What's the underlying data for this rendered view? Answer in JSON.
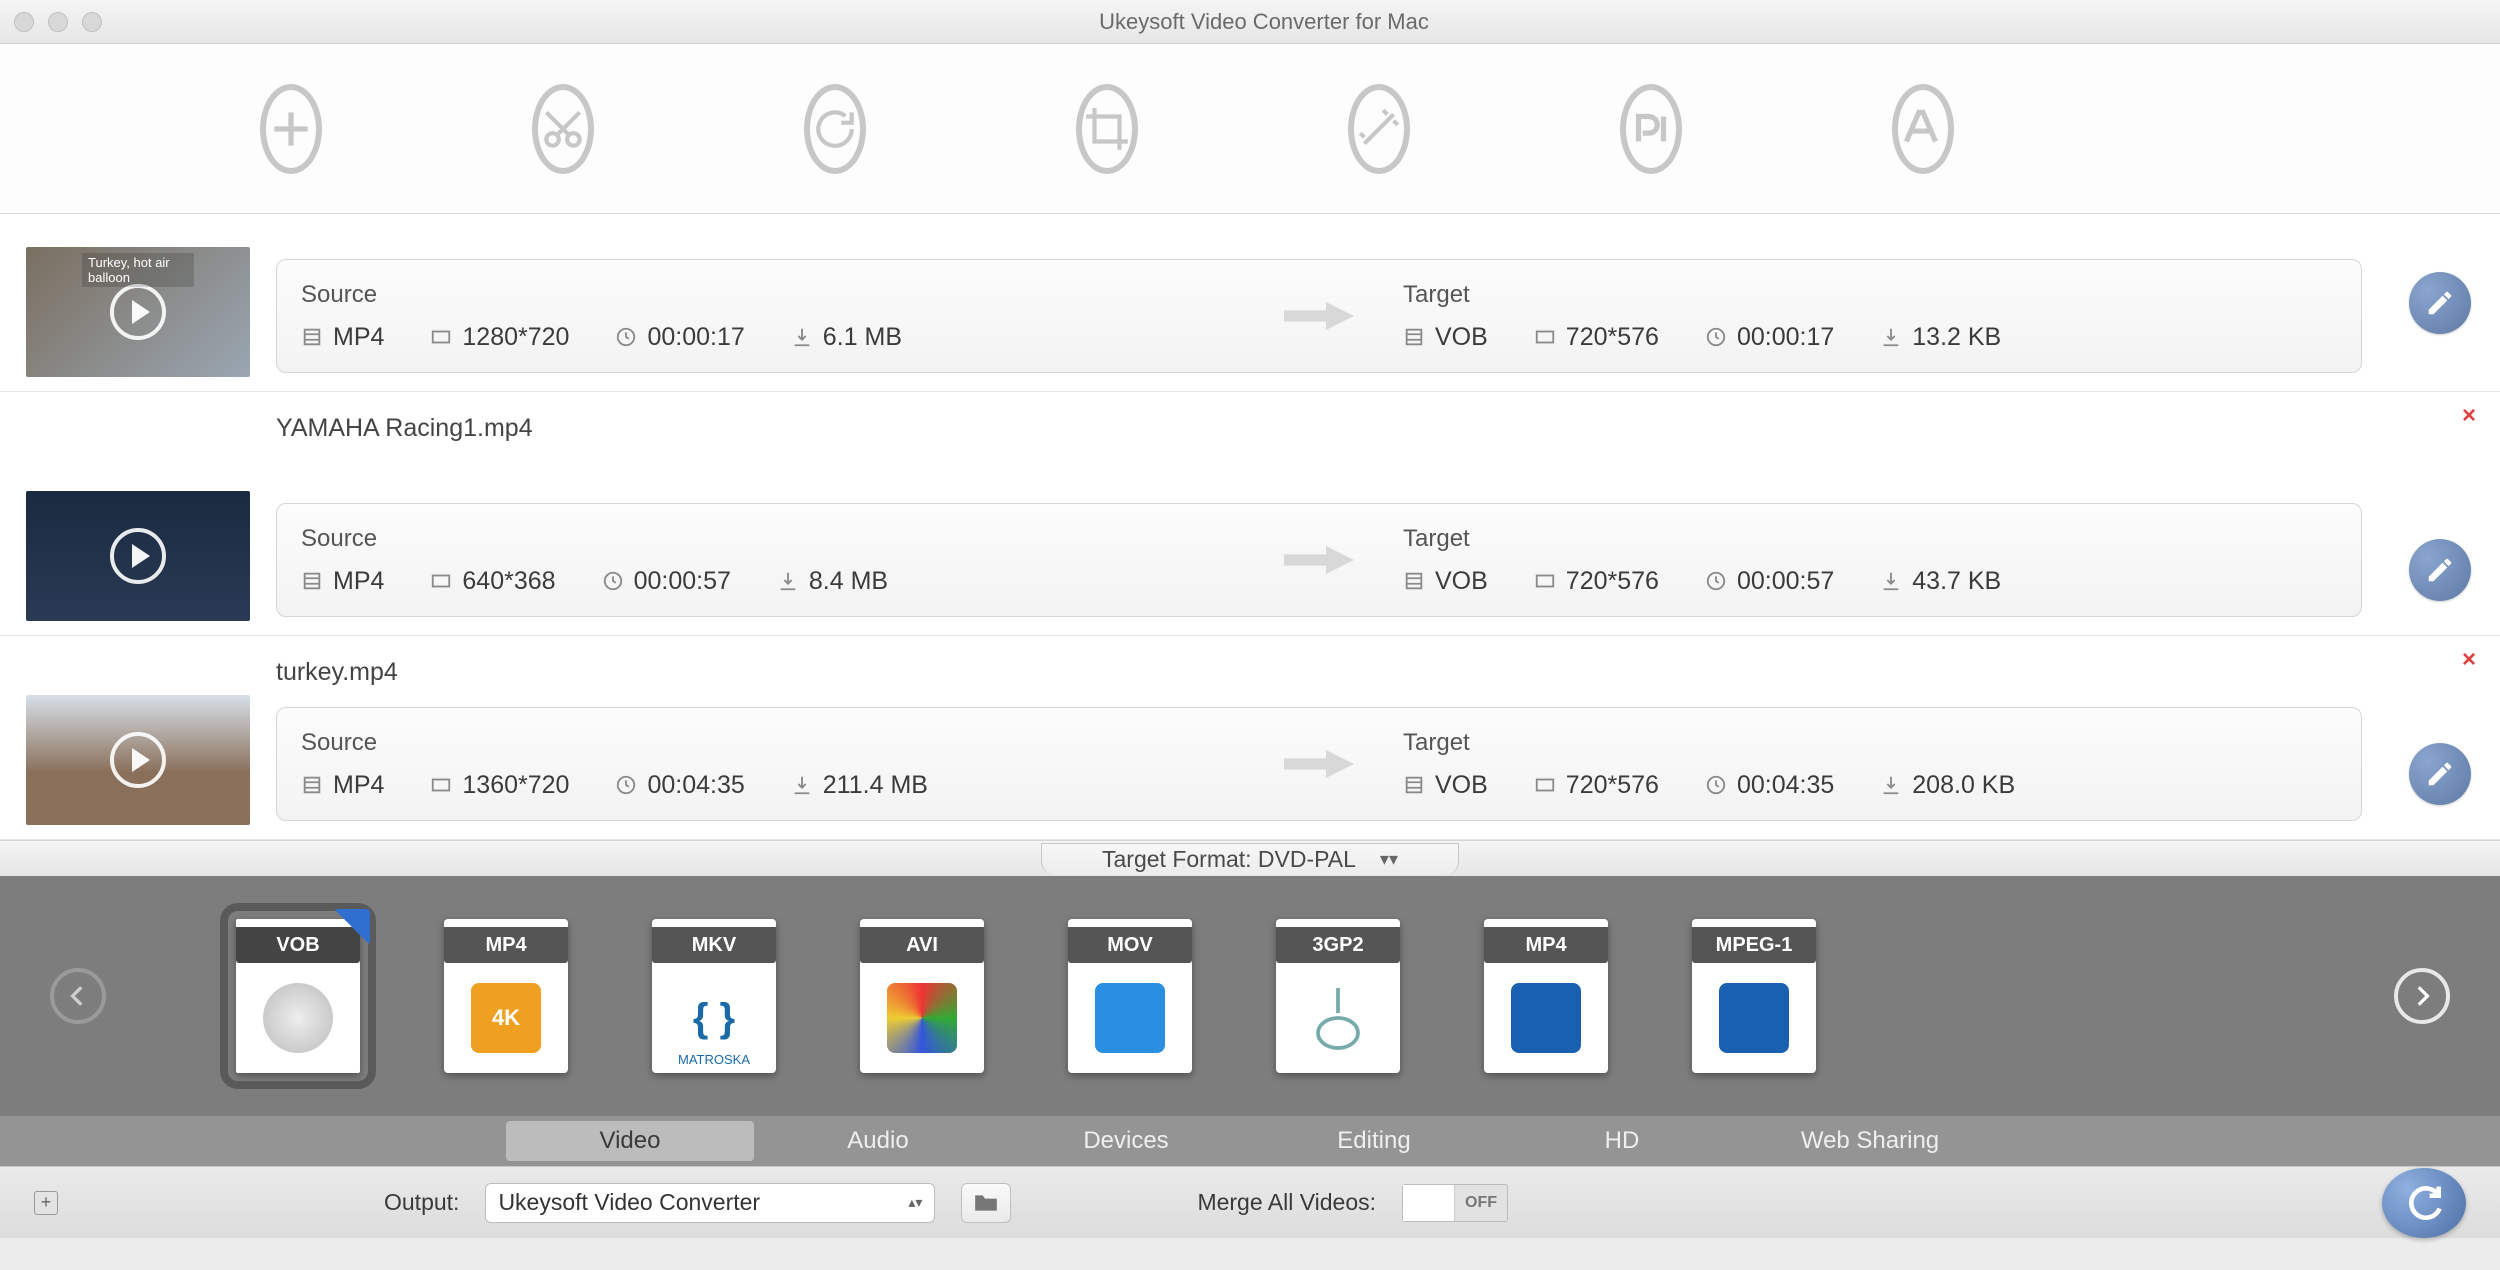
{
  "window": {
    "title": "Ukeysoft Video Converter for Mac"
  },
  "toolbar_icons": [
    "add",
    "trim",
    "rotate",
    "crop",
    "effects",
    "subtitle",
    "watermark"
  ],
  "labels": {
    "source": "Source",
    "target": "Target"
  },
  "files": [
    {
      "name": "",
      "thumb_overlay": "Turkey, hot air balloon",
      "source": {
        "format": "MP4",
        "resolution": "1280*720",
        "duration": "00:00:17",
        "size": "6.1 MB"
      },
      "target": {
        "format": "VOB",
        "resolution": "720*576",
        "duration": "00:00:17",
        "size": "13.2 KB"
      }
    },
    {
      "name": "YAMAHA Racing1.mp4",
      "source": {
        "format": "MP4",
        "resolution": "640*368",
        "duration": "00:00:57",
        "size": "8.4 MB"
      },
      "target": {
        "format": "VOB",
        "resolution": "720*576",
        "duration": "00:00:57",
        "size": "43.7 KB"
      }
    },
    {
      "name": "turkey.mp4",
      "source": {
        "format": "MP4",
        "resolution": "1360*720",
        "duration": "00:04:35",
        "size": "211.4 MB"
      },
      "target": {
        "format": "VOB",
        "resolution": "720*576",
        "duration": "00:04:35",
        "size": "208.0 KB"
      }
    }
  ],
  "target_format": {
    "label": "Target Format: DVD-PAL"
  },
  "formats": [
    {
      "code": "VOB",
      "selected": true
    },
    {
      "code": "MP4",
      "sub": "4K"
    },
    {
      "code": "MKV",
      "sub": "MATROSKA"
    },
    {
      "code": "AVI"
    },
    {
      "code": "MOV"
    },
    {
      "code": "3GP2"
    },
    {
      "code": "MP4"
    },
    {
      "code": "MPEG-1"
    }
  ],
  "categories": [
    "Video",
    "Audio",
    "Devices",
    "Editing",
    "HD",
    "Web Sharing"
  ],
  "active_category": "Video",
  "bottom": {
    "output_label": "Output:",
    "output_value": "Ukeysoft Video Converter",
    "merge_label": "Merge All Videos:",
    "merge_state": "OFF"
  }
}
